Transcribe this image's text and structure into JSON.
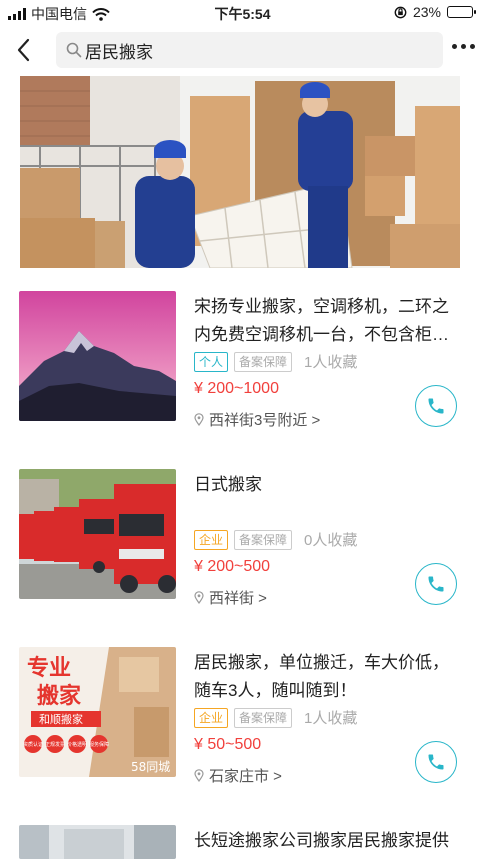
{
  "status": {
    "carrier": "中国电信",
    "time": "下午5:54",
    "battery": "23%",
    "battery_level": 0.23
  },
  "nav": {
    "search_text": "居民搬家"
  },
  "listings": [
    {
      "title": "宋扬专业搬家，空调移机，二环之内免费空调移机一台，不包含柜…",
      "tag_type": "个人",
      "tag_guard": "备案保障",
      "favorites": "1人收藏",
      "price": "¥ 200~1000",
      "location": "西祥街3号附近 >"
    },
    {
      "title": "日式搬家",
      "tag_type": "企业",
      "tag_guard": "备案保障",
      "favorites": "0人收藏",
      "price": "¥ 200~500",
      "location": "西祥街 >"
    },
    {
      "title": "居民搬家，单位搬迁，车大价低，随车3人，随叫随到！",
      "tag_type": "企业",
      "tag_guard": "备案保障",
      "favorites": "1人收藏",
      "price": "¥ 50~500",
      "location": "石家庄市 >",
      "thumb_text": {
        "line1": "专业",
        "line2": "搬家",
        "ribbon": "和顺搬家",
        "badges": [
          "资质认证",
          "正规发票",
          "价格透明",
          "服务保障"
        ],
        "brand": "58同城"
      }
    },
    {
      "title": "长短途搬家公司搬家居民搬家提供"
    }
  ]
}
